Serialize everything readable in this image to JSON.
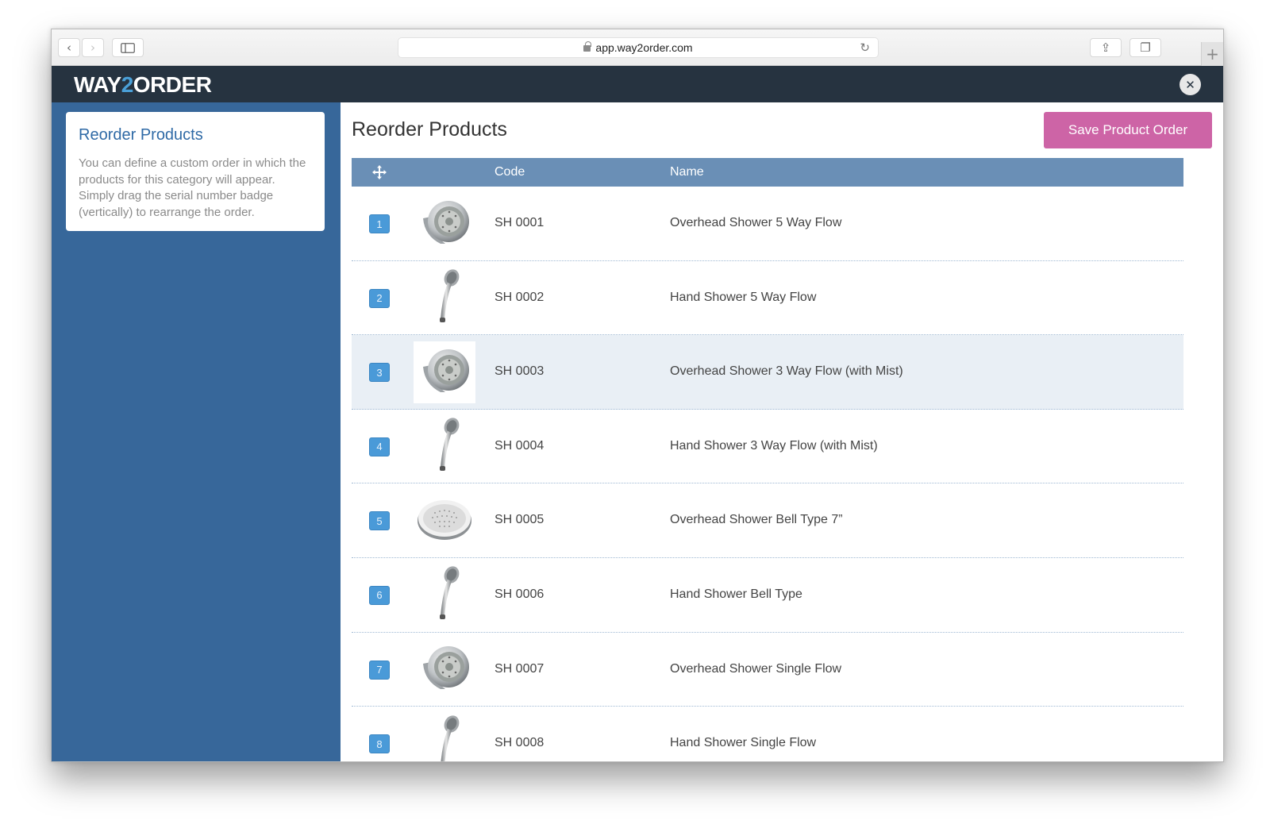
{
  "browser": {
    "url": "app.way2order.com",
    "back_glyph": "‹",
    "forward_glyph": "›",
    "reload_glyph": "↻",
    "share_glyph": "⇪",
    "tabs_glyph": "❐",
    "newtab_glyph": "+"
  },
  "header": {
    "logo_prefix": "WAY",
    "logo_two": "2",
    "logo_suffix": "ORDER",
    "close_glyph": "✕"
  },
  "sidebar": {
    "title": "Reorder Products",
    "description": "You can define a custom order in which the products for this category will appear. Simply drag the serial number badge (vertically) to rearrange the order."
  },
  "main": {
    "title": "Reorder Products",
    "save_label": "Save Product Order",
    "columns": {
      "code": "Code",
      "name": "Name"
    },
    "rows": [
      {
        "num": "1",
        "code": "SH 0001",
        "name": "Overhead Shower 5 Way Flow",
        "thumb": "overhead-shower-icon"
      },
      {
        "num": "2",
        "code": "SH 0002",
        "name": "Hand Shower 5 Way Flow",
        "thumb": "hand-shower-icon"
      },
      {
        "num": "3",
        "code": "SH 0003",
        "name": "Overhead Shower 3 Way Flow (with Mist)",
        "thumb": "overhead-shower-icon"
      },
      {
        "num": "4",
        "code": "SH 0004",
        "name": "Hand Shower 3 Way Flow (with Mist)",
        "thumb": "hand-shower-icon"
      },
      {
        "num": "5",
        "code": "SH 0005",
        "name": "Overhead Shower Bell Type 7”",
        "thumb": "bell-shower-icon"
      },
      {
        "num": "6",
        "code": "SH 0006",
        "name": "Hand Shower Bell Type",
        "thumb": "hand-shower-icon"
      },
      {
        "num": "7",
        "code": "SH 0007",
        "name": "Overhead Shower Single Flow",
        "thumb": "overhead-shower-icon"
      },
      {
        "num": "8",
        "code": "SH 0008",
        "name": "Hand Shower Single Flow",
        "thumb": "hand-shower-icon"
      }
    ]
  },
  "colors": {
    "header_bg": "#263340",
    "sidebar_bg": "#37679a",
    "table_head_bg": "#6a8fb6",
    "save_button": "#cd64a6",
    "badge": "#4a9ad8",
    "highlight_row": "#e9eff5"
  }
}
